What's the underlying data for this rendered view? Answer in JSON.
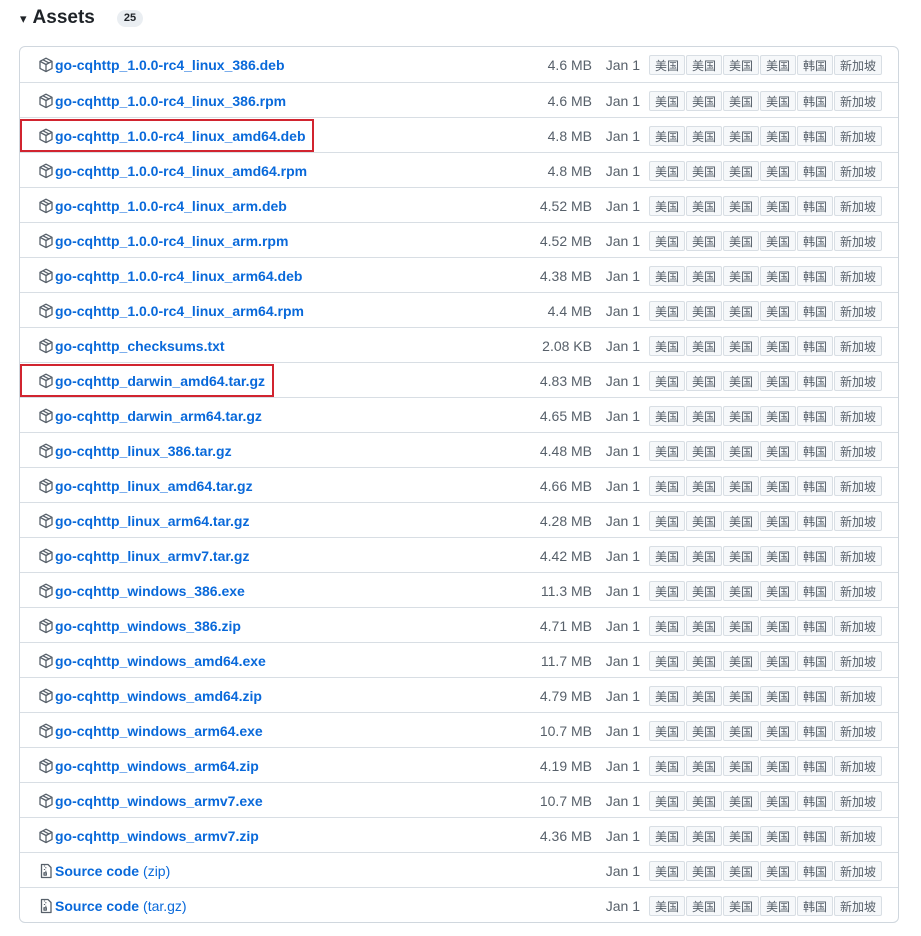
{
  "header": {
    "caret": "▾",
    "title": "Assets",
    "count": "25"
  },
  "mirror_labels": [
    "美国",
    "美国",
    "美国",
    "美国",
    "韩国",
    "新加坡"
  ],
  "assets": [
    {
      "name": "go-cqhttp_1.0.0-rc4_linux_386.deb",
      "size": "4.6 MB",
      "date": "Jan 1",
      "icon": "package-icon"
    },
    {
      "name": "go-cqhttp_1.0.0-rc4_linux_386.rpm",
      "size": "4.6 MB",
      "date": "Jan 1",
      "icon": "package-icon"
    },
    {
      "name": "go-cqhttp_1.0.0-rc4_linux_amd64.deb",
      "size": "4.8 MB",
      "date": "Jan 1",
      "icon": "package-icon",
      "highlighted": true
    },
    {
      "name": "go-cqhttp_1.0.0-rc4_linux_amd64.rpm",
      "size": "4.8 MB",
      "date": "Jan 1",
      "icon": "package-icon"
    },
    {
      "name": "go-cqhttp_1.0.0-rc4_linux_arm.deb",
      "size": "4.52 MB",
      "date": "Jan 1",
      "icon": "package-icon"
    },
    {
      "name": "go-cqhttp_1.0.0-rc4_linux_arm.rpm",
      "size": "4.52 MB",
      "date": "Jan 1",
      "icon": "package-icon"
    },
    {
      "name": "go-cqhttp_1.0.0-rc4_linux_arm64.deb",
      "size": "4.38 MB",
      "date": "Jan 1",
      "icon": "package-icon"
    },
    {
      "name": "go-cqhttp_1.0.0-rc4_linux_arm64.rpm",
      "size": "4.4 MB",
      "date": "Jan 1",
      "icon": "package-icon"
    },
    {
      "name": "go-cqhttp_checksums.txt",
      "size": "2.08 KB",
      "date": "Jan 1",
      "icon": "package-icon"
    },
    {
      "name": "go-cqhttp_darwin_amd64.tar.gz",
      "size": "4.83 MB",
      "date": "Jan 1",
      "icon": "package-icon",
      "highlighted": true
    },
    {
      "name": "go-cqhttp_darwin_arm64.tar.gz",
      "size": "4.65 MB",
      "date": "Jan 1",
      "icon": "package-icon"
    },
    {
      "name": "go-cqhttp_linux_386.tar.gz",
      "size": "4.48 MB",
      "date": "Jan 1",
      "icon": "package-icon"
    },
    {
      "name": "go-cqhttp_linux_amd64.tar.gz",
      "size": "4.66 MB",
      "date": "Jan 1",
      "icon": "package-icon"
    },
    {
      "name": "go-cqhttp_linux_arm64.tar.gz",
      "size": "4.28 MB",
      "date": "Jan 1",
      "icon": "package-icon"
    },
    {
      "name": "go-cqhttp_linux_armv7.tar.gz",
      "size": "4.42 MB",
      "date": "Jan 1",
      "icon": "package-icon"
    },
    {
      "name": "go-cqhttp_windows_386.exe",
      "size": "11.3 MB",
      "date": "Jan 1",
      "icon": "package-icon"
    },
    {
      "name": "go-cqhttp_windows_386.zip",
      "size": "4.71 MB",
      "date": "Jan 1",
      "icon": "package-icon"
    },
    {
      "name": "go-cqhttp_windows_amd64.exe",
      "size": "11.7 MB",
      "date": "Jan 1",
      "icon": "package-icon"
    },
    {
      "name": "go-cqhttp_windows_amd64.zip",
      "size": "4.79 MB",
      "date": "Jan 1",
      "icon": "package-icon"
    },
    {
      "name": "go-cqhttp_windows_arm64.exe",
      "size": "10.7 MB",
      "date": "Jan 1",
      "icon": "package-icon"
    },
    {
      "name": "go-cqhttp_windows_arm64.zip",
      "size": "4.19 MB",
      "date": "Jan 1",
      "icon": "package-icon"
    },
    {
      "name": "go-cqhttp_windows_armv7.exe",
      "size": "10.7 MB",
      "date": "Jan 1",
      "icon": "package-icon"
    },
    {
      "name": "go-cqhttp_windows_armv7.zip",
      "size": "4.36 MB",
      "date": "Jan 1",
      "icon": "package-icon"
    },
    {
      "name": "Source code",
      "suffix": "(zip)",
      "size": "",
      "date": "Jan 1",
      "icon": "file-zip-icon"
    },
    {
      "name": "Source code",
      "suffix": "(tar.gz)",
      "size": "",
      "date": "Jan 1",
      "icon": "file-zip-icon"
    }
  ],
  "colors": {
    "link": "#0969da",
    "highlight": "#d1242f",
    "muted": "#57606a"
  }
}
